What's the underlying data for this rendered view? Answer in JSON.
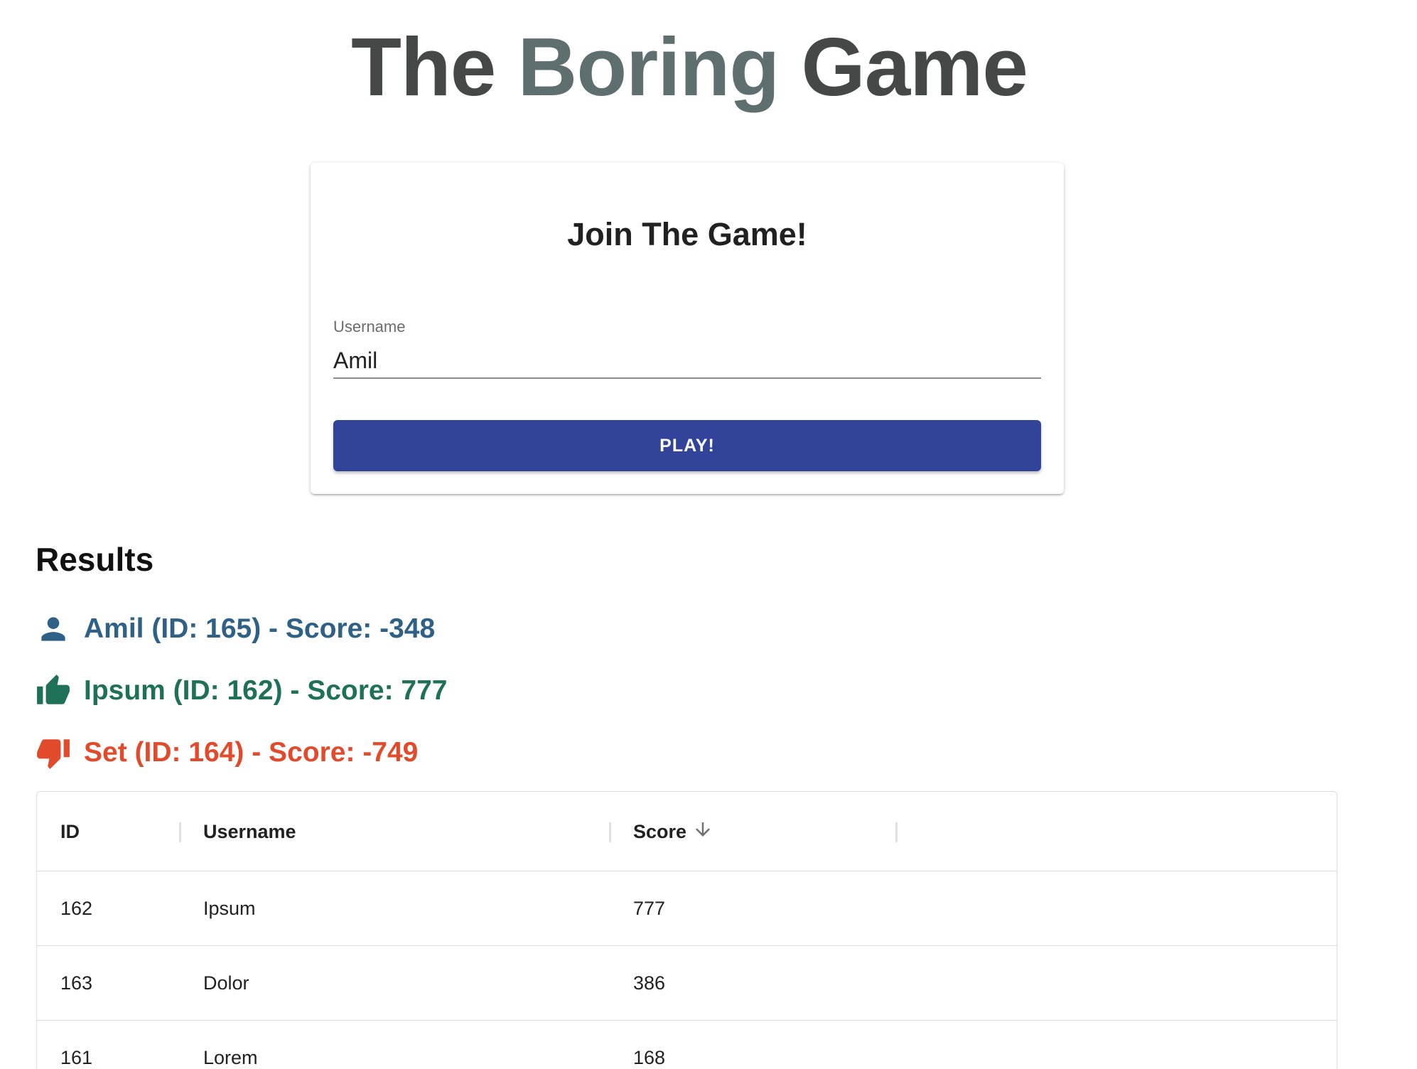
{
  "header": {
    "title_part1": "The",
    "title_accent": "Boring",
    "title_part2": "Game"
  },
  "join_card": {
    "title": "Join The Game!",
    "username_label": "Username",
    "username_value": "Amil",
    "play_label": "PLAY!"
  },
  "results": {
    "heading": "Results",
    "items": [
      {
        "icon": "person-icon",
        "text": "Amil (ID: 165) - Score: -348",
        "color": "#2e6185"
      },
      {
        "icon": "thumbs-up-icon",
        "text": "Ipsum (ID: 162) - Score: 777",
        "color": "#1f7058"
      },
      {
        "icon": "thumbs-down-icon",
        "text": "Set (ID: 164) - Score: -749",
        "color": "#e24a2c"
      }
    ]
  },
  "table": {
    "columns": [
      "ID",
      "Username",
      "Score"
    ],
    "sort_icon": "arrow-down-icon",
    "rows": [
      {
        "id": "162",
        "username": "Ipsum",
        "score": "777"
      },
      {
        "id": "163",
        "username": "Dolor",
        "score": "386"
      },
      {
        "id": "161",
        "username": "Lorem",
        "score": "168"
      }
    ]
  },
  "colors": {
    "title": "#444847",
    "title_accent": "#5f6f70",
    "primary_button": "#32439a"
  }
}
